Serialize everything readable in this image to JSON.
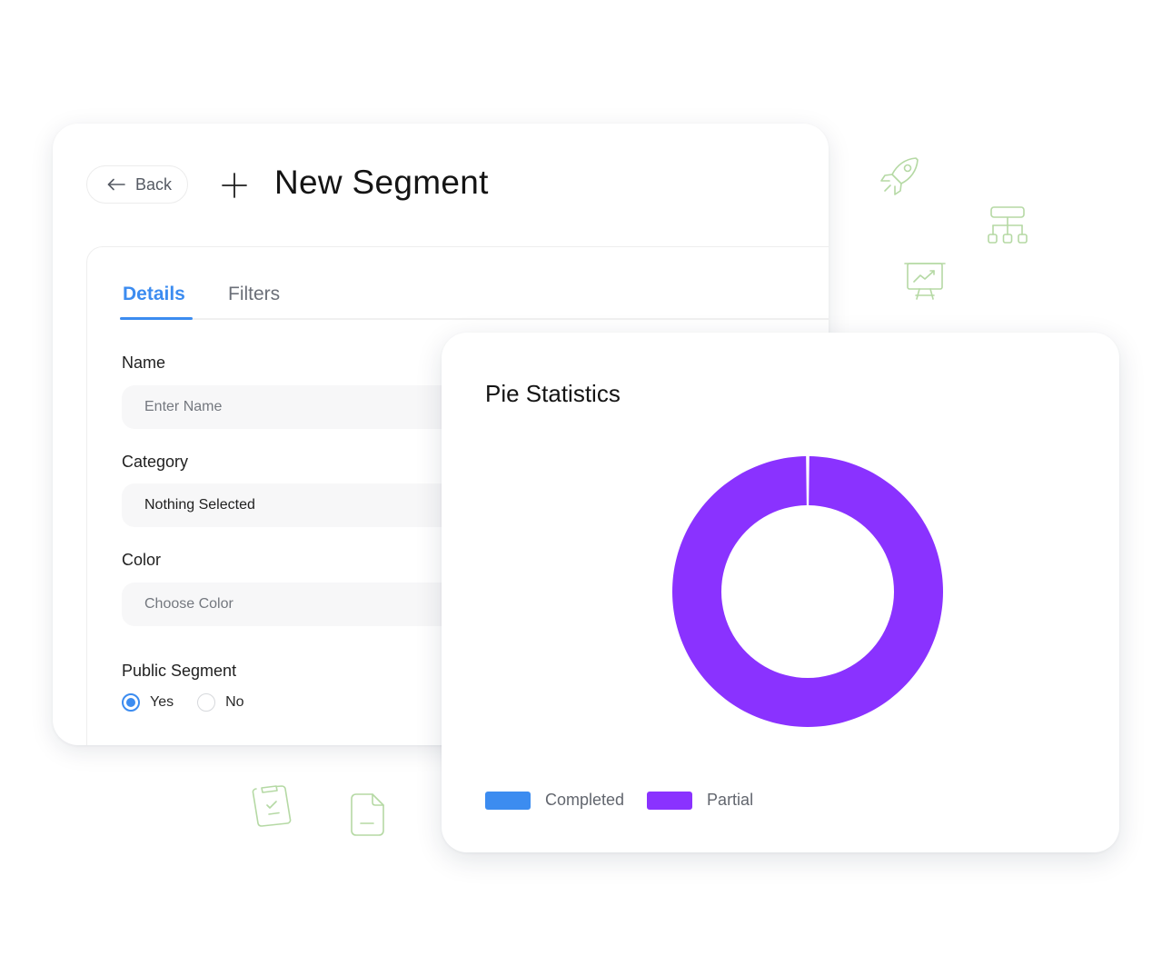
{
  "form": {
    "back_label": "Back",
    "title": "New Segment",
    "tabs": [
      {
        "label": "Details",
        "active": true
      },
      {
        "label": "Filters",
        "active": false
      }
    ],
    "fields": {
      "name": {
        "label": "Name",
        "placeholder": "Enter Name"
      },
      "category": {
        "label": "Category",
        "value": "Nothing Selected"
      },
      "color": {
        "label": "Color",
        "placeholder": "Choose Color"
      }
    },
    "public_segment": {
      "label": "Public Segment",
      "options": [
        {
          "label": "Yes",
          "selected": true
        },
        {
          "label": "No",
          "selected": false
        }
      ]
    }
  },
  "chart": {
    "title": "Pie Statistics",
    "legend": [
      {
        "label": "Completed",
        "color": "#3c8cf0"
      },
      {
        "label": "Partial",
        "color": "#8a32ff"
      }
    ]
  },
  "chart_data": {
    "type": "pie",
    "variant": "donut",
    "title": "Pie Statistics",
    "categories": [
      "Completed",
      "Partial"
    ],
    "values": [
      0,
      100
    ],
    "colors": [
      "#3c8cf0",
      "#8a32ff"
    ],
    "legend": "bottom-left"
  },
  "colors": {
    "accent": "#3c8cf0",
    "partial": "#8a32ff",
    "doodle": "#b5d9a4"
  },
  "icons": [
    "back-arrow-icon",
    "plus-icon",
    "rocket-icon",
    "sitemap-icon",
    "presentation-chart-icon",
    "clipboard-check-icon",
    "document-icon"
  ]
}
